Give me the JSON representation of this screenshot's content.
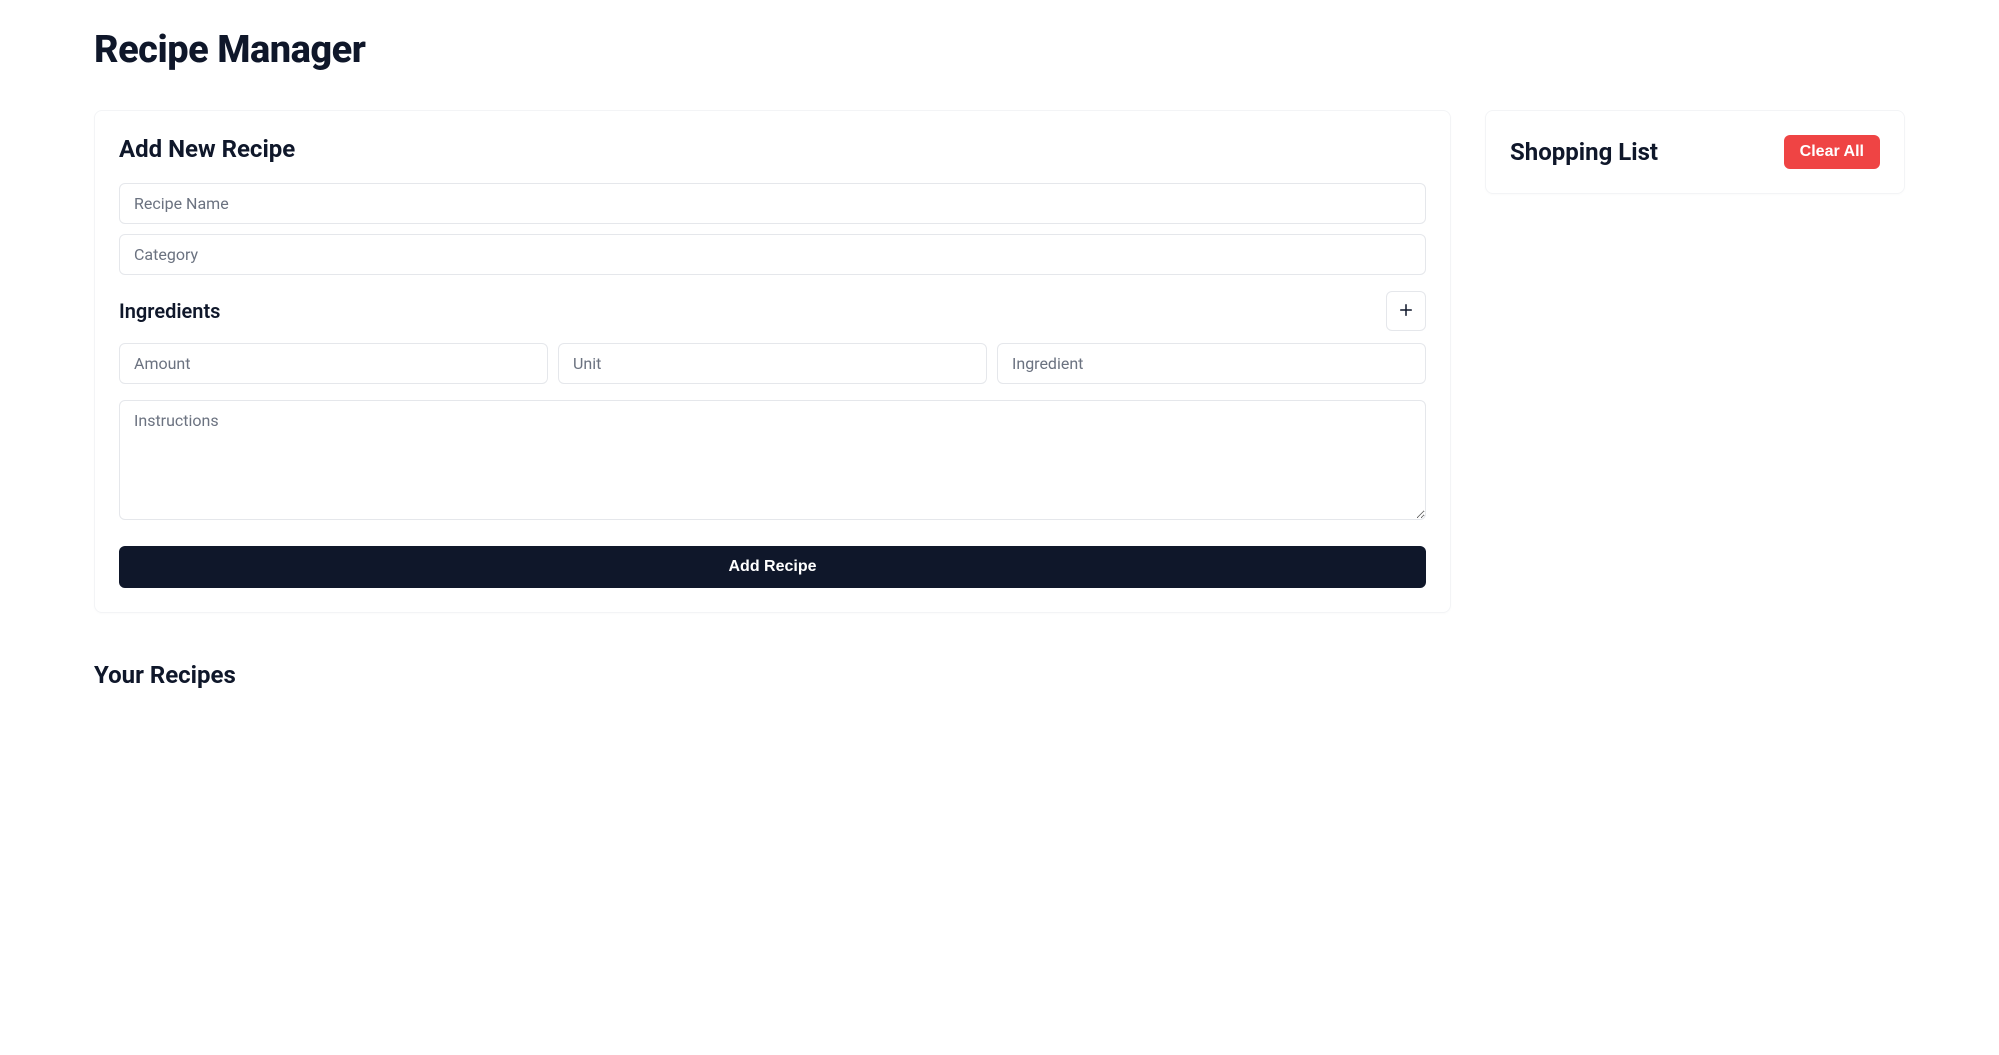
{
  "page": {
    "title": "Recipe Manager"
  },
  "addRecipe": {
    "title": "Add New Recipe",
    "recipeName": {
      "placeholder": "Recipe Name",
      "value": ""
    },
    "category": {
      "placeholder": "Category",
      "value": ""
    },
    "ingredientsLabel": "Ingredients",
    "ingredientRow": {
      "amount": {
        "placeholder": "Amount",
        "value": ""
      },
      "unit": {
        "placeholder": "Unit",
        "value": ""
      },
      "ingredient": {
        "placeholder": "Ingredient",
        "value": ""
      }
    },
    "instructions": {
      "placeholder": "Instructions",
      "value": ""
    },
    "submitLabel": "Add Recipe"
  },
  "yourRecipes": {
    "title": "Your Recipes"
  },
  "shoppingList": {
    "title": "Shopping List",
    "clearLabel": "Clear All"
  }
}
